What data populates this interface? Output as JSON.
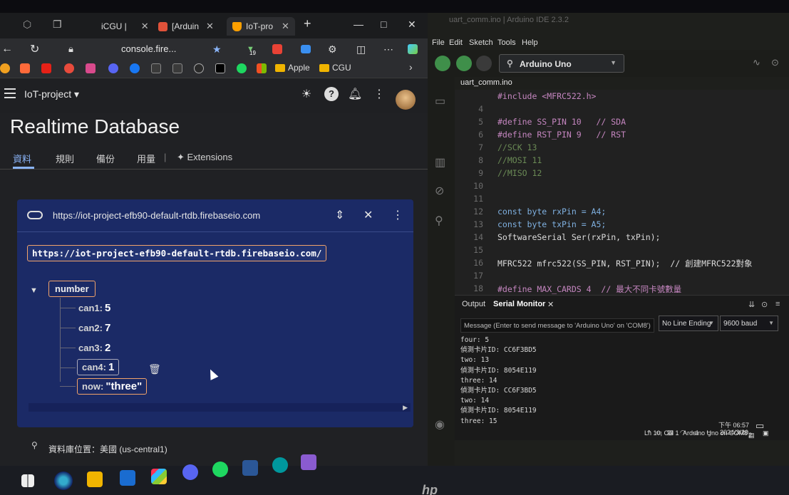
{
  "browser": {
    "tabs": [
      {
        "label": "iCGU |",
        "favicon_color": "#444"
      },
      {
        "label": "[Arduin",
        "favicon_color": "#e0523a"
      },
      {
        "label": "IoT-pro",
        "favicon_color": "#ffa000"
      }
    ],
    "new_tab": "+",
    "window_controls": {
      "minimize": "—",
      "maximize": "□",
      "close": "✕"
    },
    "address": "console.fire...",
    "extension_badge": "19",
    "bookmark_folders": [
      "Apple",
      "CGU"
    ]
  },
  "firebase": {
    "project": "IoT-project",
    "page_title": "Realtime Database",
    "tabs": [
      "資料",
      "規則",
      "備份",
      "用量",
      "Extensions"
    ],
    "active_tab": "資料",
    "db_url": "https://iot-project-efb90-default-rtdb.firebaseio.com",
    "ref_url": "https://iot-project-efb90-default-rtdb.firebaseio.com/",
    "root_node": "number",
    "leaves": [
      {
        "key": "can1:",
        "value": "5"
      },
      {
        "key": "can2:",
        "value": "7"
      },
      {
        "key": "can3:",
        "value": "2"
      },
      {
        "key": "can4:",
        "value": "1"
      },
      {
        "key": "now:",
        "value": "\"three\""
      }
    ],
    "location": "資料庫位置：美國 (us-central1)"
  },
  "ide": {
    "title": "uart_comm.ino | Arduino IDE 2.3.2",
    "menu": [
      "File",
      "Edit",
      "Sketch",
      "Tools",
      "Help"
    ],
    "board": "Arduino Uno",
    "file_tab": "uart_comm.ino",
    "code_lines": [
      {
        "num": "",
        "text": "#include <MFRC522.h>"
      },
      {
        "num": "4",
        "text": ""
      },
      {
        "num": "5",
        "text": "#define SS_PIN 10   // SDA"
      },
      {
        "num": "6",
        "text": "#define RST_PIN 9   // RST"
      },
      {
        "num": "7",
        "text": "//SCK 13"
      },
      {
        "num": "8",
        "text": "//MOSI 11"
      },
      {
        "num": "9",
        "text": "//MISO 12"
      },
      {
        "num": "10",
        "text": ""
      },
      {
        "num": "11",
        "text": ""
      },
      {
        "num": "12",
        "text": "const byte rxPin = A4;"
      },
      {
        "num": "13",
        "text": "const byte txPin = A5;"
      },
      {
        "num": "14",
        "text": "SoftwareSerial Ser(rxPin, txPin);"
      },
      {
        "num": "15",
        "text": ""
      },
      {
        "num": "16",
        "text": "MFRC522 mfrc522(SS_PIN, RST_PIN);  // 創建MFRC522對象"
      },
      {
        "num": "17",
        "text": ""
      },
      {
        "num": "18",
        "text": "#define MAX_CARDS 4  // 最大不同卡號數量"
      }
    ],
    "output_tabs": [
      "Output",
      "Serial Monitor"
    ],
    "message_placeholder": "Message (Enter to send message to 'Arduino Uno' on 'COM8')",
    "line_ending": "No Line Ending",
    "baud": "9600 baud",
    "serial_lines": [
      "four: 5",
      "偵測卡片ID: CC6F3BD5",
      "two: 13",
      "偵測卡片ID: 8054E119",
      "three: 14",
      "偵測卡片ID: CC6F3BD5",
      "two: 14",
      "偵測卡片ID: 8054E119",
      "three: 15"
    ],
    "status": {
      "position": "Ln 10, Col 1",
      "board": "Arduino Uno on COM8",
      "count": "2"
    }
  },
  "taskbar": {
    "time": "下午 06:57",
    "date": "2024/3/20",
    "brand": "hp"
  }
}
